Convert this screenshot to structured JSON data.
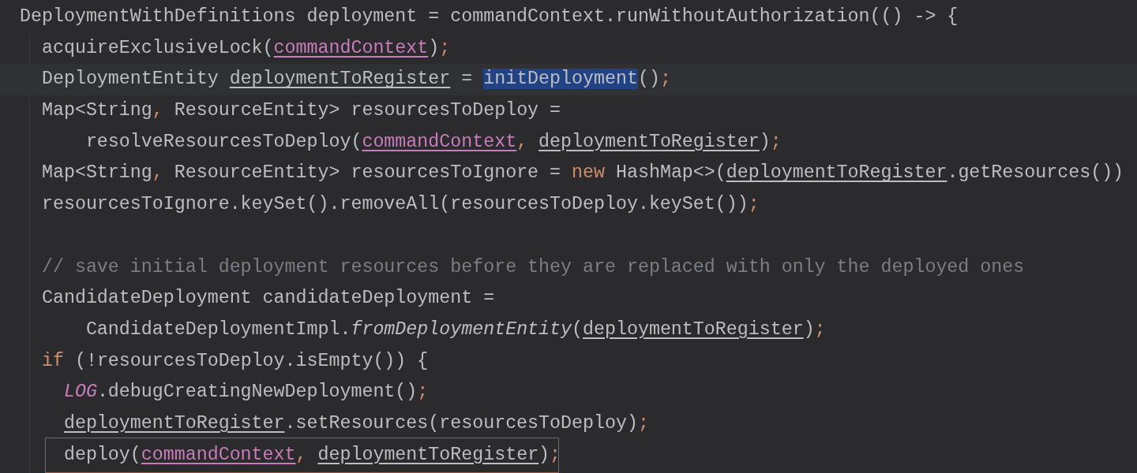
{
  "editor": {
    "lines": [
      {
        "kind": "code",
        "current": false,
        "flagged": false,
        "tokens": [
          {
            "text": "DeploymentWithDefinitions deployment = commandContext.runWithoutAuthorization(() -> {",
            "kind": "plain"
          }
        ]
      },
      {
        "kind": "code",
        "current": false,
        "flagged": false,
        "tokens": [
          {
            "text": "  acquireExclusiveLock(",
            "kind": "plain"
          },
          {
            "text": "commandContext",
            "kind": "param"
          },
          {
            "text": ")",
            "kind": "plain"
          },
          {
            "text": ";",
            "kind": "punct"
          }
        ]
      },
      {
        "kind": "code",
        "current": true,
        "flagged": false,
        "tokens": [
          {
            "text": "  DeploymentEntity ",
            "kind": "plain"
          },
          {
            "text": "deploymentToRegister",
            "kind": "local"
          },
          {
            "text": " = ",
            "kind": "plain"
          },
          {
            "text": "initDeployment",
            "kind": "selected"
          },
          {
            "text": "()",
            "kind": "plain"
          },
          {
            "text": ";",
            "kind": "punct"
          }
        ]
      },
      {
        "kind": "code",
        "current": false,
        "flagged": false,
        "tokens": [
          {
            "text": "  Map<String",
            "kind": "plain"
          },
          {
            "text": ",",
            "kind": "punct"
          },
          {
            "text": " ResourceEntity> resourcesToDeploy =",
            "kind": "plain"
          }
        ]
      },
      {
        "kind": "code",
        "current": false,
        "flagged": false,
        "tokens": [
          {
            "text": "      resolveResourcesToDeploy(",
            "kind": "plain"
          },
          {
            "text": "commandContext",
            "kind": "param"
          },
          {
            "text": ", ",
            "kind": "punct"
          },
          {
            "text": "deploymentToRegister",
            "kind": "local"
          },
          {
            "text": ")",
            "kind": "plain"
          },
          {
            "text": ";",
            "kind": "punct"
          }
        ]
      },
      {
        "kind": "code",
        "current": false,
        "flagged": false,
        "tokens": [
          {
            "text": "  Map<String",
            "kind": "plain"
          },
          {
            "text": ",",
            "kind": "punct"
          },
          {
            "text": " ResourceEntity> resourcesToIgnore = ",
            "kind": "plain"
          },
          {
            "text": "new",
            "kind": "keyword"
          },
          {
            "text": " HashMap<>(",
            "kind": "plain"
          },
          {
            "text": "deploymentToRegister",
            "kind": "local"
          },
          {
            "text": ".getResources())",
            "kind": "plain"
          }
        ]
      },
      {
        "kind": "code",
        "current": false,
        "flagged": false,
        "tokens": [
          {
            "text": "  resourcesToIgnore.keySet().removeAll(resourcesToDeploy.keySet())",
            "kind": "plain"
          },
          {
            "text": ";",
            "kind": "punct"
          }
        ]
      },
      {
        "kind": "blank"
      },
      {
        "kind": "code",
        "current": false,
        "flagged": false,
        "tokens": [
          {
            "text": "  // save initial deployment resources before they are replaced with only the deployed ones",
            "kind": "comment"
          }
        ]
      },
      {
        "kind": "code",
        "current": false,
        "flagged": false,
        "tokens": [
          {
            "text": "  CandidateDeployment candidateDeployment =",
            "kind": "plain"
          }
        ]
      },
      {
        "kind": "code",
        "current": false,
        "flagged": false,
        "tokens": [
          {
            "text": "      CandidateDeploymentImpl.",
            "kind": "plain"
          },
          {
            "text": "fromDeploymentEntity",
            "kind": "static-method"
          },
          {
            "text": "(",
            "kind": "plain"
          },
          {
            "text": "deploymentToRegister",
            "kind": "local"
          },
          {
            "text": ")",
            "kind": "plain"
          },
          {
            "text": ";",
            "kind": "punct"
          }
        ]
      },
      {
        "kind": "code",
        "current": false,
        "flagged": false,
        "tokens": [
          {
            "text": "  if",
            "kind": "keyword"
          },
          {
            "text": " (!resourcesToDeploy.isEmpty()) {",
            "kind": "plain"
          }
        ]
      },
      {
        "kind": "code",
        "current": false,
        "flagged": false,
        "tokens": [
          {
            "text": "    LOG",
            "kind": "static"
          },
          {
            "text": ".debugCreatingNewDeployment()",
            "kind": "plain"
          },
          {
            "text": ";",
            "kind": "punct"
          }
        ]
      },
      {
        "kind": "code",
        "current": false,
        "flagged": false,
        "tokens": [
          {
            "text": "    deploymentToRegister",
            "kind": "local"
          },
          {
            "text": ".setResources(resourcesToDeploy)",
            "kind": "plain"
          },
          {
            "text": ";",
            "kind": "punct"
          }
        ]
      },
      {
        "kind": "code",
        "current": false,
        "flagged": true,
        "tokens": [
          {
            "text": "    deploy(",
            "kind": "plain"
          },
          {
            "text": "commandContext",
            "kind": "param"
          },
          {
            "text": ", ",
            "kind": "punct"
          },
          {
            "text": "deploymentToRegister",
            "kind": "local"
          },
          {
            "text": ")",
            "kind": "plain"
          },
          {
            "text": ";",
            "kind": "punct"
          }
        ]
      }
    ]
  }
}
